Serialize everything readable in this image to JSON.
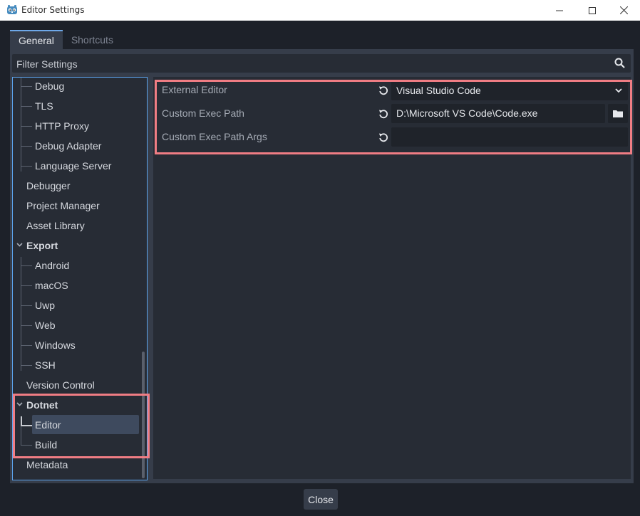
{
  "window": {
    "title": "Editor Settings"
  },
  "tabs": [
    {
      "label": "General",
      "active": true
    },
    {
      "label": "Shortcuts",
      "active": false
    }
  ],
  "filter": {
    "placeholder": "Filter Settings"
  },
  "tree": {
    "items": [
      {
        "label": "Debug",
        "level": 2
      },
      {
        "label": "TLS",
        "level": 2
      },
      {
        "label": "HTTP Proxy",
        "level": 2
      },
      {
        "label": "Debug Adapter",
        "level": 2
      },
      {
        "label": "Language Server",
        "level": 2
      },
      {
        "label": "Debugger",
        "level": 1
      },
      {
        "label": "Project Manager",
        "level": 1
      },
      {
        "label": "Asset Library",
        "level": 1
      },
      {
        "label": "Export",
        "level": 0
      },
      {
        "label": "Android",
        "level": 2
      },
      {
        "label": "macOS",
        "level": 2
      },
      {
        "label": "Uwp",
        "level": 2
      },
      {
        "label": "Web",
        "level": 2
      },
      {
        "label": "Windows",
        "level": 2
      },
      {
        "label": "SSH",
        "level": 2
      },
      {
        "label": "Version Control",
        "level": 1
      },
      {
        "label": "Dotnet",
        "level": 0
      },
      {
        "label": "Editor",
        "level": 2,
        "selected": true
      },
      {
        "label": "Build",
        "level": 2
      },
      {
        "label": "Metadata",
        "level": 1
      }
    ]
  },
  "properties": {
    "external_editor": {
      "label": "External Editor",
      "value": "Visual Studio Code"
    },
    "custom_exec_path": {
      "label": "Custom Exec Path",
      "value": "D:\\Microsoft VS Code\\Code.exe"
    },
    "custom_exec_path_args": {
      "label": "Custom Exec Path Args",
      "value": ""
    }
  },
  "footer": {
    "close_label": "Close"
  },
  "colors": {
    "accent": "#5da6f0",
    "highlight": "#f07d84",
    "panel": "#363d4a",
    "background": "#1d2129"
  },
  "icons": {
    "app": "godot-icon",
    "search": "search-icon",
    "revert": "revert-icon",
    "dropdown": "chevron-down-icon",
    "folder": "folder-icon"
  }
}
